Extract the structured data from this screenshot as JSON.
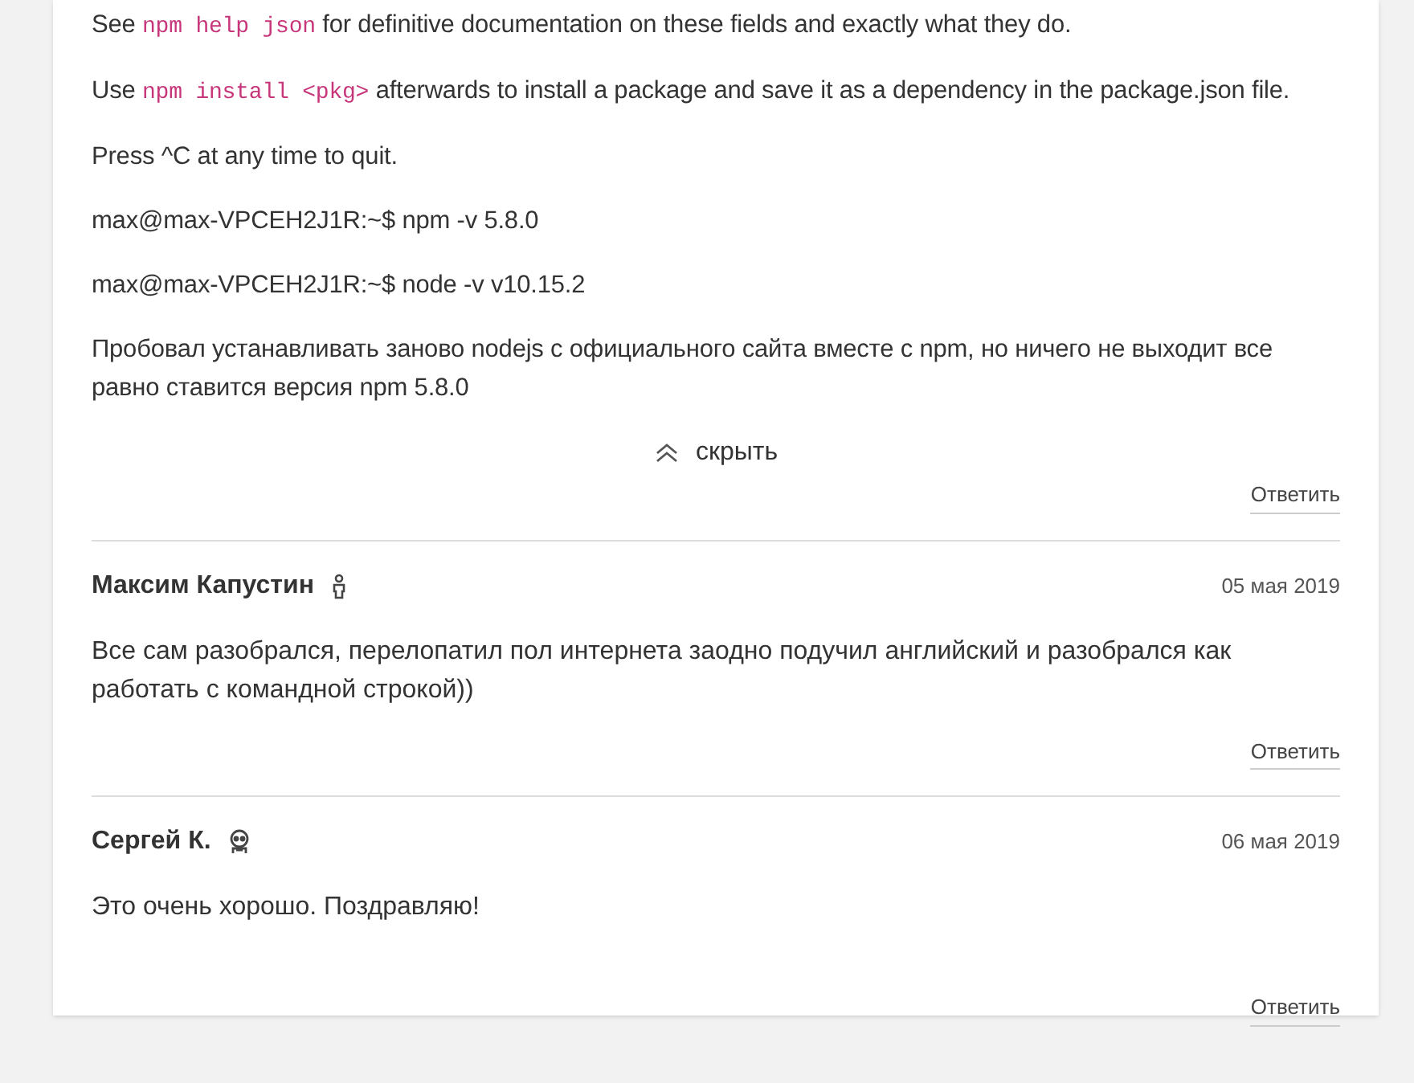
{
  "post_paragraphs": [
    [
      {
        "kind": "text",
        "text": "See "
      },
      {
        "kind": "code",
        "text": "npm help json"
      },
      {
        "kind": "text",
        "text": " for definitive documentation on these fields and exactly what they do."
      }
    ],
    [
      {
        "kind": "text",
        "text": "Use "
      },
      {
        "kind": "code",
        "text": "npm install <pkg>"
      },
      {
        "kind": "text",
        "text": " afterwards to install a package and save it as a dependency in the package.json file."
      }
    ],
    [
      {
        "kind": "text",
        "text": "Press ^C at any time to quit."
      }
    ],
    [
      {
        "kind": "text",
        "text": "max@max-VPCEH2J1R:~$ npm -v 5.8.0"
      }
    ],
    [
      {
        "kind": "text",
        "text": "max@max-VPCEH2J1R:~$ node -v v10.15.2"
      }
    ],
    [
      {
        "kind": "text",
        "text": "Пробовал устанавливать заново nodejs с официального сайта вместе с npm, но ничего не выходит все равно ставится версия npm 5.8.0"
      }
    ]
  ],
  "collapse_label": "скрыть",
  "post_reply": "Ответить",
  "comments": [
    {
      "author": "Максим Капустин",
      "badge": {
        "kind": "person"
      },
      "date": "05 мая 2019",
      "text": "Все сам разобрался, перелопатил пол интернета заодно подучил английский и разобрался как работать с командной строкой))",
      "reply": "Ответить"
    },
    {
      "author": "Сергей К.",
      "badge": {
        "kind": "robot"
      },
      "date": "06 мая 2019",
      "text": "Это очень хорошо. Поздравляю!",
      "reply": "Ответить"
    }
  ]
}
